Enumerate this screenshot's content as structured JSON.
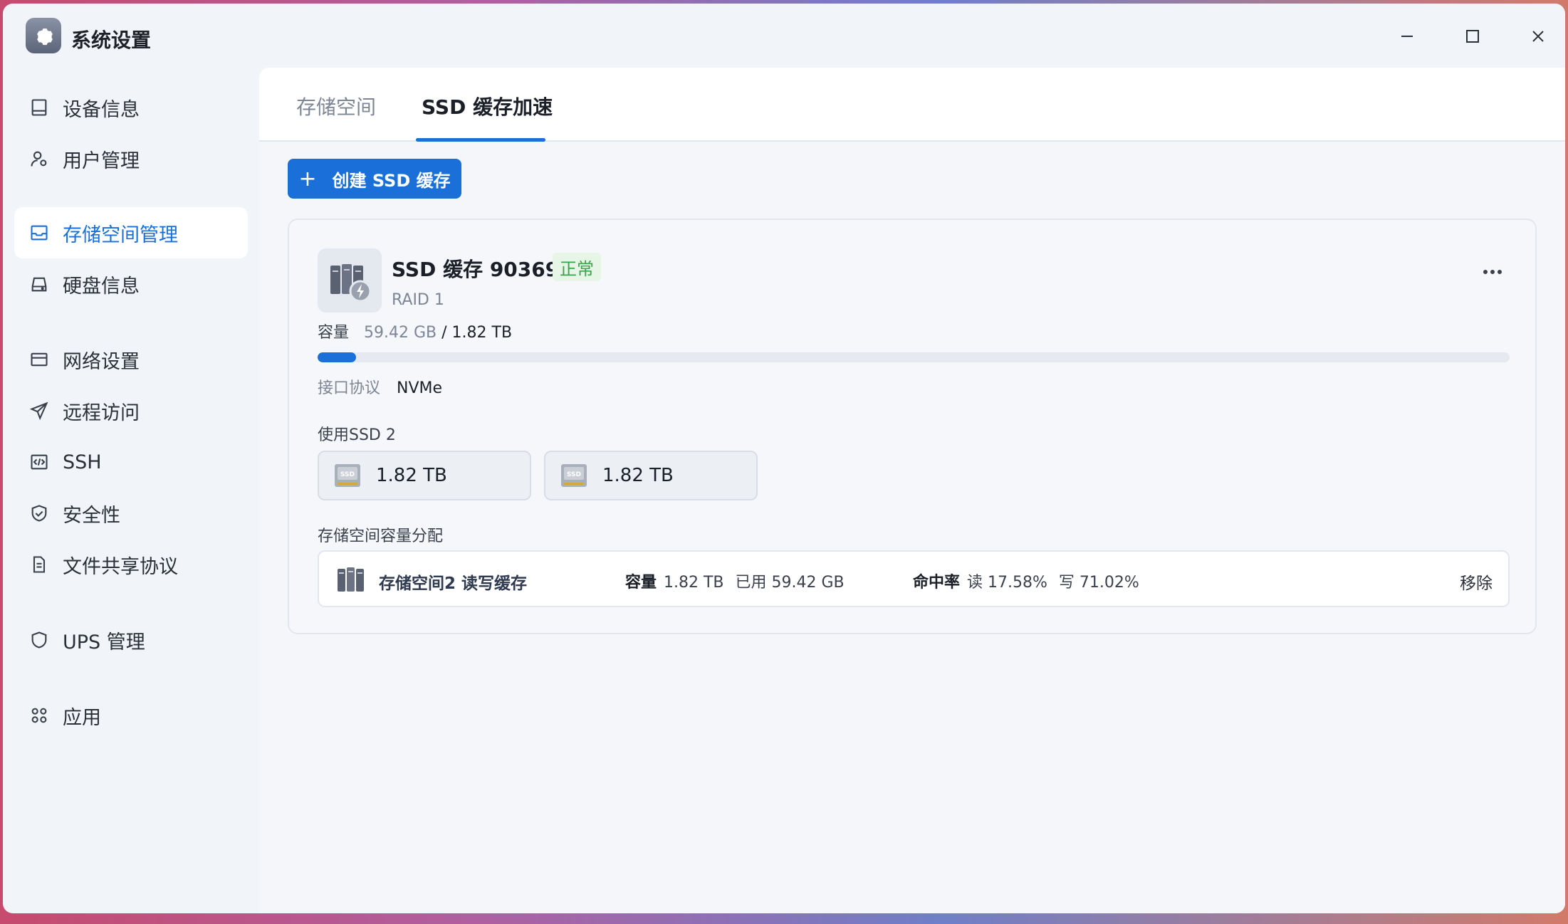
{
  "app": {
    "title": "系统设置",
    "icon": "gear-icon"
  },
  "window_controls": [
    "minimize-icon",
    "maximize-icon",
    "close-icon"
  ],
  "sidebar": {
    "items": [
      {
        "label": "设备信息",
        "icon": "device-icon"
      },
      {
        "label": "用户管理",
        "icon": "user-gear-icon"
      },
      {
        "label": "存储空间管理",
        "icon": "storage-icon",
        "active": true
      },
      {
        "label": "硬盘信息",
        "icon": "hard-disk-icon"
      },
      {
        "label": "网络设置",
        "icon": "network-icon"
      },
      {
        "label": "远程访问",
        "icon": "send-icon"
      },
      {
        "label": "SSH",
        "icon": "code-icon"
      },
      {
        "label": "安全性",
        "icon": "shield-check-icon"
      },
      {
        "label": "文件共享协议",
        "icon": "document-icon"
      },
      {
        "label": "UPS 管理",
        "icon": "shield-icon"
      },
      {
        "label": "应用",
        "icon": "apps-icon"
      }
    ]
  },
  "tabs": [
    {
      "label": "存储空间",
      "active": false
    },
    {
      "label": "SSD 缓存加速",
      "active": true
    }
  ],
  "toolbar": {
    "create_plus": "+",
    "create_label": "创建 SSD 缓存"
  },
  "cache": {
    "title": "SSD 缓存 90369",
    "status": "正常",
    "raid": "RAID 1",
    "capacity_label": "容量",
    "used": "59.42 GB",
    "total": "/ 1.82 TB",
    "usage_fraction": 0.032,
    "interface_label": "接口协议",
    "interface_value": "NVMe",
    "use_ssd_label": "使用SSD 2",
    "disks": [
      {
        "size": "1.82 TB",
        "icon": "ssd-icon"
      },
      {
        "size": "1.82 TB",
        "icon": "ssd-icon"
      }
    ],
    "allocation_label": "存储空间容量分配",
    "allocation": {
      "name": "存储空间2  读写缓存",
      "cap_label": "容量",
      "cap_value": "1.82 TB",
      "used_text": "已用 59.42 GB",
      "hit_label": "命中率",
      "read_text": "读 17.58%",
      "write_text": "写 71.02%",
      "remove_label": "移除"
    }
  },
  "colors": {
    "accent": "#1a6fd8",
    "status_ok": "#3aa44d"
  }
}
